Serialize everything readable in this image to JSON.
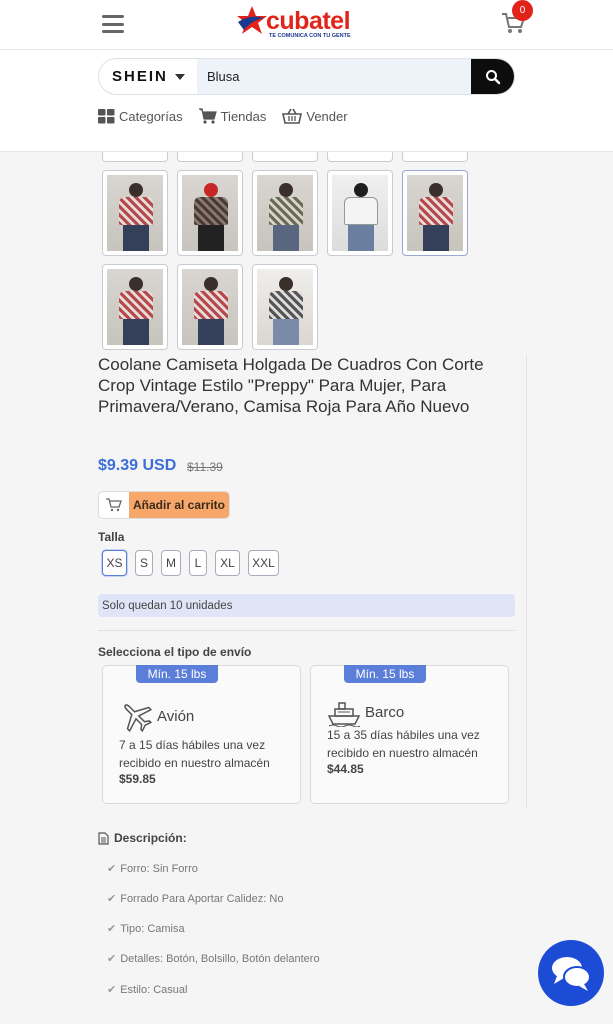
{
  "header": {
    "logo_text": "cubatel",
    "logo_tagline": "TE COMUNICA CON TU GENTE",
    "cart_count": "0"
  },
  "search": {
    "store": "SHEIN",
    "value": "Blusa",
    "placeholder": ""
  },
  "nav": {
    "categories": "Categorías",
    "stores": "Tiendas",
    "sell": "Vender"
  },
  "product": {
    "title": "Coolane Camiseta Holgada De Cuadros Con Corte Crop Vintage Estilo \"Preppy\" Para Mujer, Para Primavera/Verano, Camisa Roja Para Año Nuevo",
    "price": "$9.39 USD",
    "old_price": "$11.39",
    "add_to_cart": "Añadir al carrito",
    "size_label": "Talla",
    "sizes": [
      "XS",
      "S",
      "M",
      "L",
      "XL",
      "XXL"
    ],
    "stock_note": "Solo quedan 10 unidades"
  },
  "shipping": {
    "label": "Selecciona el tipo de envío",
    "options": [
      {
        "badge": "Mín. 15 lbs",
        "name": "Avión",
        "desc": "7 a 15 días hábiles una vez recibido en nuestro almacén",
        "cost": "$59.85"
      },
      {
        "badge": "Mín. 15 lbs",
        "name": "Barco",
        "desc": "15 a 35 días hábiles una vez recibido en nuestro almacén",
        "cost": "$44.85"
      }
    ]
  },
  "description": {
    "title": "Descripción:",
    "features": [
      "Forro: Sin Forro",
      "Forrado Para Aportar Calidez: No",
      "Tipo: Camisa",
      "Detalles: Botón, Bolsillo, Botón delantero",
      "Estilo: Casual"
    ]
  },
  "colors": {
    "accent_blue": "#3a6fd8",
    "badge_blue": "#5b7ed8",
    "cart_orange": "#f7a76a",
    "brand_red": "#e2231a",
    "chat_blue": "#1c4bd6"
  }
}
